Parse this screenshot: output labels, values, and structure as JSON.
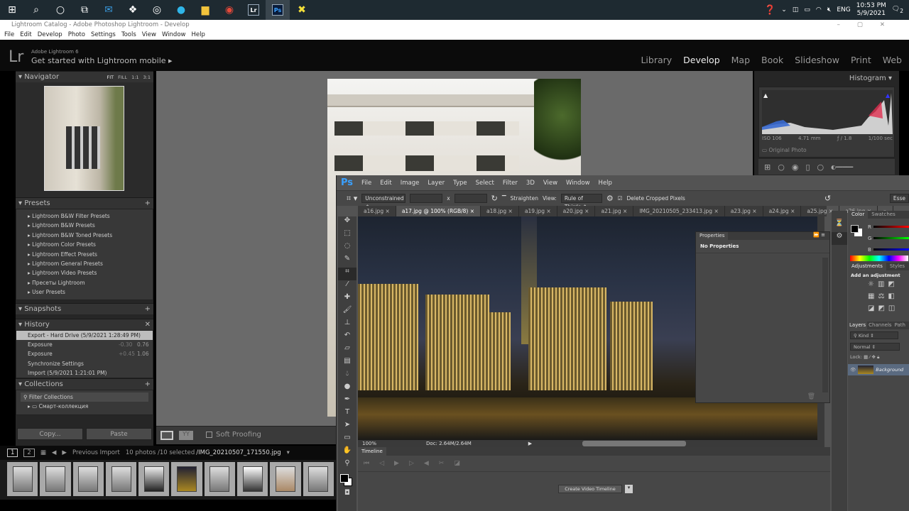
{
  "taskbar": {
    "icons": [
      "windows-start",
      "search",
      "cortana",
      "task-view",
      "mail",
      "dropbox",
      "app-circle",
      "edge",
      "file-explorer",
      "chrome",
      "lightroom",
      "photoshop",
      "xampp"
    ],
    "lr_label": "Lr",
    "ps_label": "Ps",
    "tray": {
      "lang": "ENG",
      "time": "10:53 PM",
      "date": "5/9/2021",
      "notifications": "2"
    }
  },
  "lr": {
    "window_title": "Lightroom Catalog - Adobe Photoshop Lightroom - Develop",
    "menu": [
      "File",
      "Edit",
      "Develop",
      "Photo",
      "Settings",
      "Tools",
      "View",
      "Window",
      "Help"
    ],
    "logo": "Lr",
    "product": "Adobe Lightroom 6",
    "mobile_prompt": "Get started with Lightroom mobile ▸",
    "modules": [
      "Library",
      "Develop",
      "Map",
      "Book",
      "Slideshow",
      "Print",
      "Web"
    ],
    "active_module": "Develop",
    "navigator": {
      "title": "Navigator",
      "zoom": [
        "FIT",
        "FILL",
        "1:1",
        "3:1"
      ]
    },
    "presets": {
      "title": "Presets",
      "items": [
        "Lightroom B&W Filter Presets",
        "Lightroom B&W Presets",
        "Lightroom B&W Toned Presets",
        "Lightroom Color Presets",
        "Lightroom Effect Presets",
        "Lightroom General Presets",
        "Lightroom Video Presets",
        "Пресеты Lightroom",
        "User Presets"
      ]
    },
    "snapshots": {
      "title": "Snapshots"
    },
    "history": {
      "title": "History",
      "items": [
        {
          "label": "Export - Hard Drive (5/9/2021 1:28:49 PM)",
          "a": "",
          "b": ""
        },
        {
          "label": "Exposure",
          "a": "-0.30",
          "b": "0.76"
        },
        {
          "label": "Exposure",
          "a": "+0.45",
          "b": "1.06"
        },
        {
          "label": "Synchronize Settings",
          "a": "",
          "b": ""
        },
        {
          "label": "Import (5/9/2021 1:21:01 PM)",
          "a": "",
          "b": ""
        }
      ]
    },
    "collections": {
      "title": "Collections",
      "filter": "Filter Collections",
      "items": [
        "Смарт-коллекция"
      ]
    },
    "copy": "Copy...",
    "paste": "Paste",
    "soft_proofing": "Soft Proofing",
    "histogram": {
      "title": "Histogram",
      "iso": "ISO 106",
      "focal": "4.71 mm",
      "aperture": "ƒ / 1.8",
      "shutter": "1/100 sec",
      "original_photo": "Original Photo"
    },
    "filmbar": {
      "pages": [
        "1",
        "2"
      ],
      "source": "Previous Import",
      "count": "10 photos /10 selected",
      "file": "/IMG_20210507_171550.jpg"
    }
  },
  "ps": {
    "logo": "Ps",
    "menu": [
      "File",
      "Edit",
      "Image",
      "Layer",
      "Type",
      "Select",
      "Filter",
      "3D",
      "View",
      "Window",
      "Help"
    ],
    "options": {
      "ratio": "Unconstrained",
      "x": "x",
      "straighten": "Straighten",
      "view_label": "View:",
      "view": "Rule of Thirds",
      "delete_cropped": "Delete Cropped Pixels",
      "workspace": "Esse"
    },
    "tabs": [
      "a16.jpg",
      "a17.jpg @ 100% (RGB/8)",
      "a18.jpg",
      "a19.jpg",
      "a20.jpg",
      "a21.jpg",
      "IMG_20210505_233413.jpg",
      "a23.jpg",
      "a24.jpg",
      "a25.jpg",
      "a26.jpg"
    ],
    "active_tab": 1,
    "status": {
      "zoom": "100%",
      "doc": "Doc: 2.64M/2.64M"
    },
    "timeline": {
      "title": "Timeline",
      "create": "Create Video Timeline"
    },
    "properties": {
      "title": "Properties",
      "empty": "No Properties"
    },
    "color": {
      "tabs": [
        "Color",
        "Swatches"
      ],
      "channels": [
        "R",
        "G",
        "B"
      ]
    },
    "adjustments": {
      "tabs": [
        "Adjustments",
        "Styles"
      ],
      "prompt": "Add an adjustment"
    },
    "layers": {
      "tabs": [
        "Layers",
        "Channels",
        "Path"
      ],
      "kind": "Kind",
      "blend": "Normal",
      "lock": "Lock:",
      "layer": "Background"
    }
  }
}
